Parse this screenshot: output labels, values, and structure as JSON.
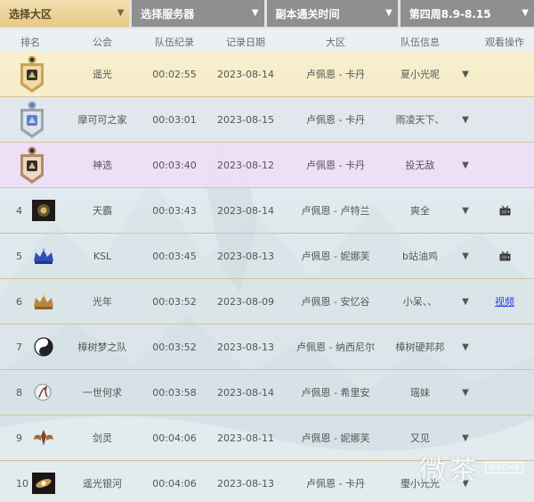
{
  "filters": [
    {
      "label": "选择大区"
    },
    {
      "label": "选择服务器"
    },
    {
      "label": "副本通关时间"
    },
    {
      "label": "第四周8.9-8.15"
    }
  ],
  "columns": [
    "排名",
    "公会",
    "队伍纪录",
    "记录日期",
    "大区",
    "队伍信息",
    "观看操作"
  ],
  "rows": [
    {
      "rank": "",
      "medal": "gold",
      "guild": "遥光",
      "time": "00:02:55",
      "date": "2023-08-14",
      "region": "卢佩恩 - 卡丹",
      "team": "夏小光呢",
      "watch": "",
      "icon": ""
    },
    {
      "rank": "",
      "medal": "silver",
      "guild": "摩可可之家",
      "time": "00:03:01",
      "date": "2023-08-15",
      "region": "卢佩恩 - 卡丹",
      "team": "雨凌天下、",
      "watch": "",
      "icon": ""
    },
    {
      "rank": "",
      "medal": "bronze",
      "guild": "神选",
      "time": "00:03:40",
      "date": "2023-08-12",
      "region": "卢佩恩 - 卡丹",
      "team": "投无敌",
      "watch": "",
      "icon": ""
    },
    {
      "rank": "4",
      "medal": "",
      "guild": "天霸",
      "time": "00:03:43",
      "date": "2023-08-14",
      "region": "卢佩恩 - 卢特兰",
      "team": "爽全",
      "watch": "tv",
      "icon": "dark-emblem"
    },
    {
      "rank": "5",
      "medal": "",
      "guild": "KSL",
      "time": "00:03:45",
      "date": "2023-08-13",
      "region": "卢佩恩 - 妮娜芙",
      "team": "b站油鸡",
      "watch": "tv",
      "icon": "blue-crown"
    },
    {
      "rank": "6",
      "medal": "",
      "guild": "光年",
      "time": "00:03:52",
      "date": "2023-08-09",
      "region": "卢佩恩 - 安忆谷",
      "team": "小呆、、",
      "watch": "视频",
      "icon": "gold-crown"
    },
    {
      "rank": "7",
      "medal": "",
      "guild": "樟树梦之队",
      "time": "00:03:52",
      "date": "2023-08-13",
      "region": "卢佩恩 - 纳西尼尔",
      "team": "樟树硬邦邦",
      "watch": "",
      "icon": "yin-yang"
    },
    {
      "rank": "8",
      "medal": "",
      "guild": "一世何求",
      "time": "00:03:58",
      "date": "2023-08-14",
      "region": "卢佩恩 - 希里安",
      "team": "瑶妹",
      "watch": "",
      "icon": "sketch-figure"
    },
    {
      "rank": "9",
      "medal": "",
      "guild": "剑灵",
      "time": "00:04:06",
      "date": "2023-08-11",
      "region": "卢佩恩 - 妮娜芙",
      "team": "又见",
      "watch": "",
      "icon": "winged-emblem"
    },
    {
      "rank": "10",
      "medal": "",
      "guild": "遥光银河",
      "time": "00:04:06",
      "date": "2023-08-13",
      "region": "卢佩恩 - 卡丹",
      "team": "璺小光光",
      "watch": "",
      "icon": "galaxy-emblem"
    }
  ],
  "watermark": {
    "text": "微茶",
    "badge": "WXCHA"
  }
}
